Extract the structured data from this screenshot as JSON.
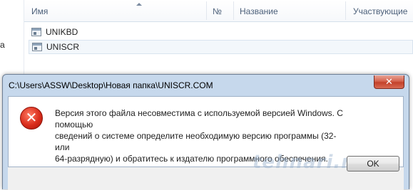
{
  "explorer": {
    "left_fragment": "а",
    "columns": {
      "name": "Имя",
      "number": "№",
      "title": "Название",
      "participants": "Участвующие"
    },
    "files": [
      {
        "name": "UNIKBD",
        "selected": false,
        "icon": "application-file-icon"
      },
      {
        "name": "UNISCR",
        "selected": true,
        "icon": "application-file-icon"
      }
    ]
  },
  "dialog": {
    "title": "C:\\Users\\ASSW\\Desktop\\Новая папка\\UNISCR.COM",
    "close_glyph": "✕",
    "icon": "error-icon",
    "message_lines": [
      "Версия этого файла несовместима с используемой версией Windows. С помощью",
      "сведений о системе определите необходимую версию программы (32- или",
      "64-разрядную) и обратитесь к издателю программного обеспечения."
    ],
    "ok_label": "OK",
    "watermark": "tehnari.ru"
  },
  "colors": {
    "dialog_frame": "#c6d8ec",
    "close_button": "#c3412a",
    "error_icon": "#d92d1c"
  }
}
